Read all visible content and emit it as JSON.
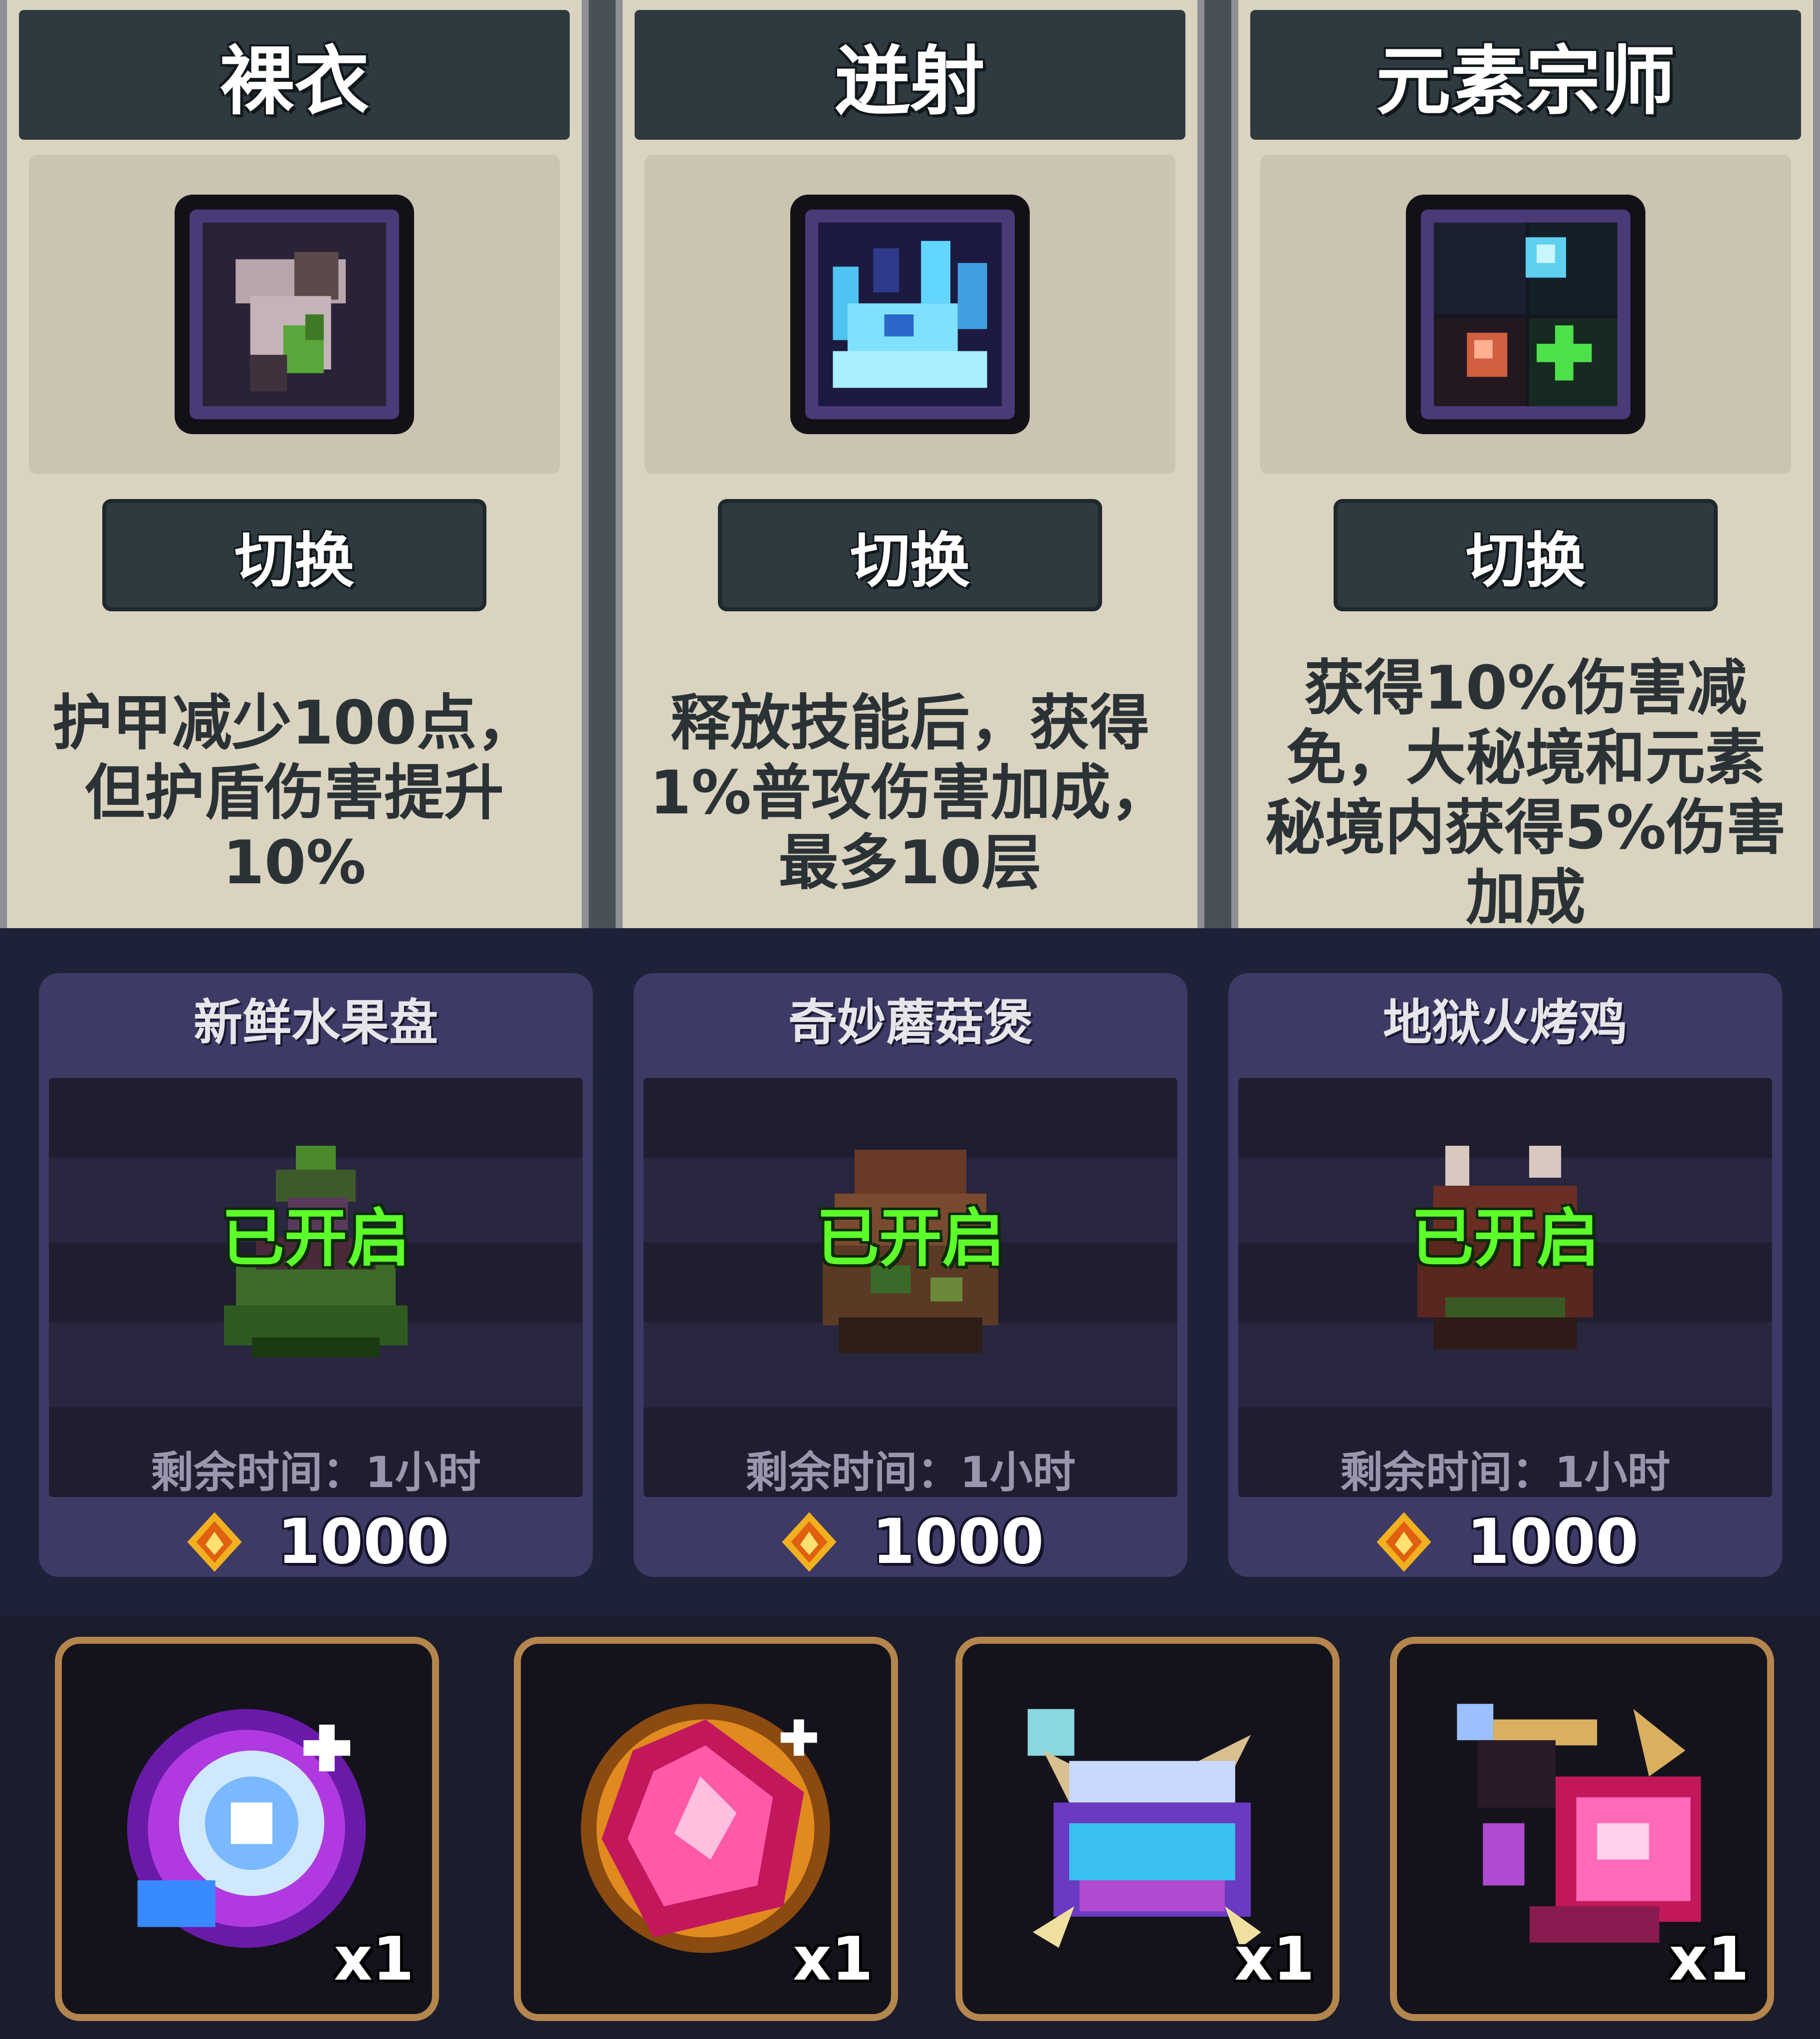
{
  "talents": [
    {
      "title": "裸衣",
      "button": "切换",
      "description": "护甲减少100点，但护盾伤害提升10%",
      "icon": "bare-armor-icon"
    },
    {
      "title": "迸射",
      "button": "切换",
      "description": "释放技能后，获得1%普攻伤害加成，最多10层",
      "icon": "burst-icon"
    },
    {
      "title": "元素宗师",
      "button": "切换",
      "description": "获得10%伤害减免，大秘境和元素秘境内获得5%伤害加成",
      "icon": "element-master-icon"
    }
  ],
  "foods": [
    {
      "name": "新鲜水果盘",
      "status": "已开启",
      "time": "剩余时间：1小时",
      "price": "1000",
      "icon": "fruit-plate-icon"
    },
    {
      "name": "奇妙蘑菇煲",
      "status": "已开启",
      "time": "剩余时间：1小时",
      "price": "1000",
      "icon": "mushroom-pot-icon"
    },
    {
      "name": "地狱火烤鸡",
      "status": "已开启",
      "time": "剩余时间：1小时",
      "price": "1000",
      "icon": "roast-chicken-icon"
    }
  ],
  "items": [
    {
      "count": "x1",
      "icon": "arcane-orb-icon"
    },
    {
      "count": "x1",
      "icon": "pink-crystal-icon"
    },
    {
      "count": "x1",
      "icon": "blue-potion-icon"
    },
    {
      "count": "x1",
      "icon": "pink-tome-icon"
    }
  ],
  "colors": {
    "status_green": "#5dff2a",
    "item_border": "#b4864e",
    "talent_header": "#2e3a40"
  }
}
